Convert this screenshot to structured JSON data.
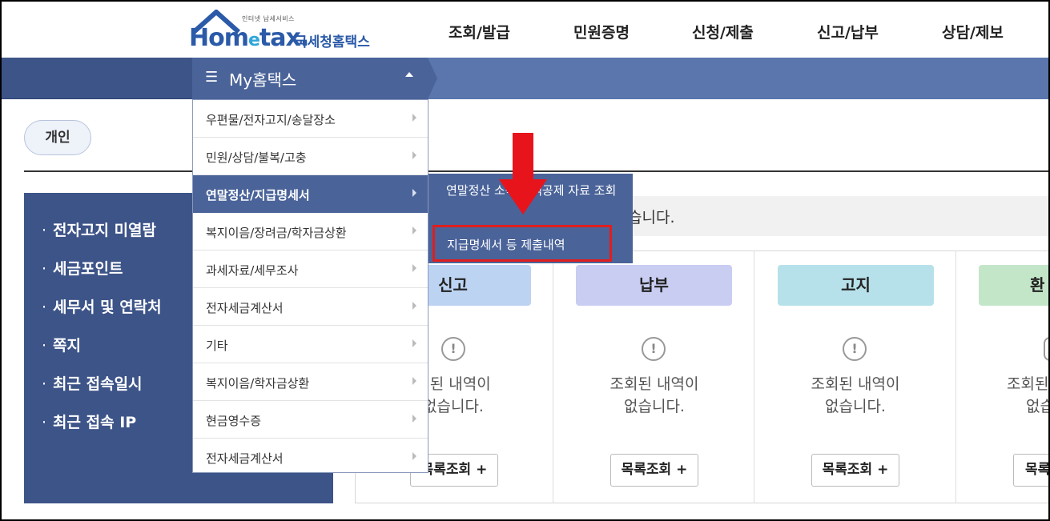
{
  "logo": {
    "small_text": "인터넷 납세서비스",
    "brand_prefix": "Hom",
    "brand_e": "e",
    "brand_suffix": "tax.",
    "korean_name": "국세청홈택스"
  },
  "gnb": [
    "조회/발급",
    "민원증명",
    "신청/제출",
    "신고/납부",
    "상담/제보"
  ],
  "my_menu": {
    "icon": "hamburger-icon",
    "label": "My홈택스",
    "toggle_icon": "caret-up-icon"
  },
  "user_tab": "개인",
  "left_panel": {
    "bullet": "·",
    "items": [
      "전자고지 미열람",
      "세금포인트",
      "세무서 및 연락처",
      "쪽지",
      "최근 접속일시",
      "최근 접속 IP"
    ]
  },
  "dropdown": {
    "items": [
      "우편물/전자고지/송달장소",
      "민원/상담/불복/고충",
      "연말정산/지급명세서",
      "복지이음/장려금/학자금상환",
      "과세자료/세무조사",
      "전자세금계산서",
      "기타",
      "복지이음/학자금상환",
      "현금영수증",
      "전자세금계산서"
    ],
    "active_index": 2
  },
  "submenu": {
    "items": [
      "연말정산 소득·세액공제 자료 조회",
      "지급명세서 등 제출내역"
    ],
    "highlighted_index": 1
  },
  "notice_text": "습니다.",
  "cards": [
    {
      "title": "신고",
      "color": "#bcd3f2",
      "empty_line1": "회된 내역이",
      "empty_line2": "없습니다.",
      "button": "목록조회 +"
    },
    {
      "title": "납부",
      "color": "#c9cdf2",
      "empty_line1": "조회된 내역이",
      "empty_line2": "없습니다.",
      "button": "목록조회 +"
    },
    {
      "title": "고지",
      "color": "#b7e1ea",
      "empty_line1": "조회된 내역이",
      "empty_line2": "없습니다.",
      "button": "목록조회 +"
    },
    {
      "title": "환",
      "color": "#c4e6c8",
      "empty_line1": "조회된",
      "empty_line2": "없습",
      "button": "목록"
    }
  ],
  "empty_icon": "exclamation-icon",
  "empty_icon_glyph": "!",
  "colors": {
    "nav_dark": "#3d5488",
    "nav_light": "#5a76ad",
    "menu_active": "#4a6399",
    "highlight_red": "#e01e1e"
  }
}
